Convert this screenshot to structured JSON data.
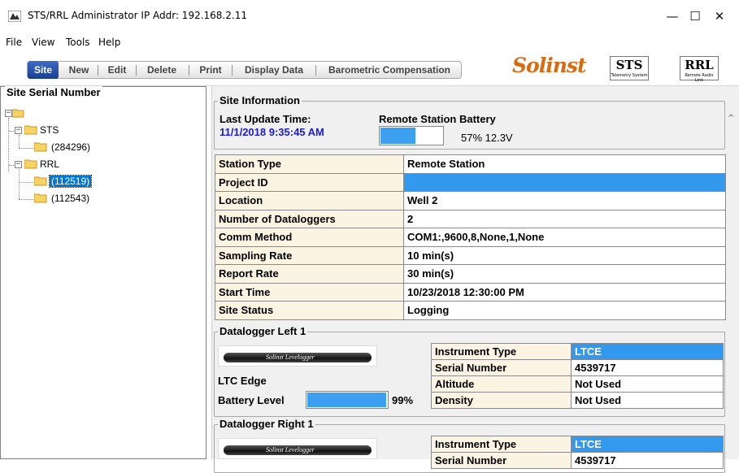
{
  "window": {
    "title": "STS/RRL Administrator IP Addr: 192.168.2.11",
    "minimize": "—",
    "maximize": "☐",
    "close": "✕"
  },
  "menu": [
    "File",
    "View",
    "Tools",
    "Help"
  ],
  "toolbar": {
    "buttons": [
      "Site",
      "New",
      "Edit",
      "Delete",
      "Print",
      "Display Data",
      "Barometric Compensation"
    ],
    "active": "Site",
    "logos": {
      "solinst": "Solinst",
      "sts": "STS",
      "sts_sub": "Telemetry System",
      "rrl": "RRL",
      "rrl_sub": "Remote Radio Link"
    }
  },
  "tree": {
    "caption": "Site Serial Number",
    "nodes": [
      {
        "label": "STS",
        "children": [
          "(284296)"
        ]
      },
      {
        "label": "RRL",
        "children": [
          "(112519)",
          "(112543)"
        ]
      }
    ],
    "selected": "(112519)"
  },
  "site_info": {
    "caption": "Site Information",
    "last_update_label": "Last Update Time:",
    "last_update_value": "11/1/2018 9:35:45 AM",
    "battery_label": "Remote Station Battery",
    "battery_text": "57% 12.3V",
    "battery_level": 0.57,
    "rows": [
      {
        "key": "Station Type",
        "value": "Remote Station"
      },
      {
        "key": "Project ID",
        "value": ""
      },
      {
        "key": "Location",
        "value": "Well 2"
      },
      {
        "key": "Number of Dataloggers",
        "value": "2"
      },
      {
        "key": "Comm Method",
        "value": "COM1:,9600,8,None,1,None"
      },
      {
        "key": "Sampling Rate",
        "value": "10 min(s)"
      },
      {
        "key": "Report Rate",
        "value": "30 min(s)"
      },
      {
        "key": "Start Time",
        "value": "10/23/2018 12:30:00 PM"
      },
      {
        "key": "Site Status",
        "value": "Logging"
      }
    ]
  },
  "logger_left": {
    "caption": "Datalogger Left 1",
    "image_text": "Solinst  Levelogger",
    "model": "LTC Edge",
    "battery_label": "Battery Level",
    "battery_pct": "99%",
    "battery_level": 0.99,
    "rows": [
      {
        "key": "Instrument Type",
        "value": "LTCE"
      },
      {
        "key": "Serial Number",
        "value": "4539717"
      },
      {
        "key": "Altitude",
        "value": "Not Used"
      },
      {
        "key": "Density",
        "value": "Not Used"
      }
    ]
  },
  "logger_right": {
    "caption": "Datalogger Right 1",
    "image_text": "Solinst  Levelogger",
    "rows": [
      {
        "key": "Instrument Type",
        "value": "LTCE"
      },
      {
        "key": "Serial Number",
        "value": "4539717"
      }
    ]
  },
  "colors": {
    "accent": "#3399ee",
    "key_bg": "#fcf4e3",
    "link_blue": "#1a1adf",
    "solinst_orange": "#d96a10"
  }
}
